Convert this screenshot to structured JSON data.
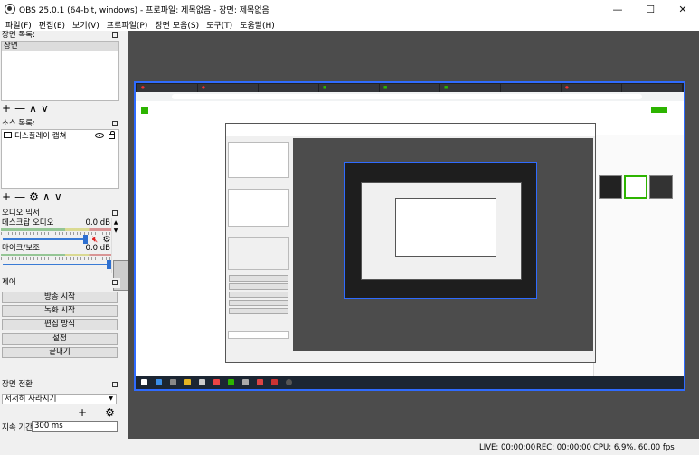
{
  "window": {
    "title": "OBS 25.0.1 (64-bit, windows) - 프로파일: 제목없음 - 장면: 제목없음",
    "minimize": "—",
    "maximize": "☐",
    "close": "✕"
  },
  "menu": [
    "파일(F)",
    "편집(E)",
    "보기(V)",
    "프로파일(P)",
    "장면 모음(S)",
    "도구(T)",
    "도움말(H)"
  ],
  "scenes": {
    "title": "장면 목록:",
    "items": [
      "장면"
    ],
    "toolbar": [
      "+",
      "—",
      "∧",
      "∨"
    ]
  },
  "sources": {
    "title": "소스 목록:",
    "items": [
      "디스플레이 캡쳐"
    ],
    "toolbar": [
      "+",
      "—",
      "⚙",
      "∧",
      "∨"
    ]
  },
  "mixer": {
    "title": "오디오 믹서",
    "channels": [
      {
        "name": "데스크탑 오디오",
        "level": "0.0 dB"
      },
      {
        "name": "마이크/보조",
        "level": "0.0 dB"
      }
    ]
  },
  "controls": {
    "title": "제어",
    "buttons": [
      "방송 시작",
      "녹화 시작",
      "편집 방식",
      "설정",
      "끝내기"
    ]
  },
  "transitions": {
    "title": "장면 전환",
    "selected": "서서히 사라지기",
    "toolbar": [
      "+",
      "—",
      "⚙"
    ],
    "duration_label": "지속 기간",
    "duration_value": "300 ms"
  },
  "status": {
    "live": "LIVE: 00:00:00",
    "rec": "REC: 00:00:00",
    "cpu": "CPU: 6.9%, 60.00 fps"
  },
  "colors": {
    "accent_blue": "#2f6bff",
    "mute_red": "#e02020",
    "blog_green": "#2db400"
  }
}
